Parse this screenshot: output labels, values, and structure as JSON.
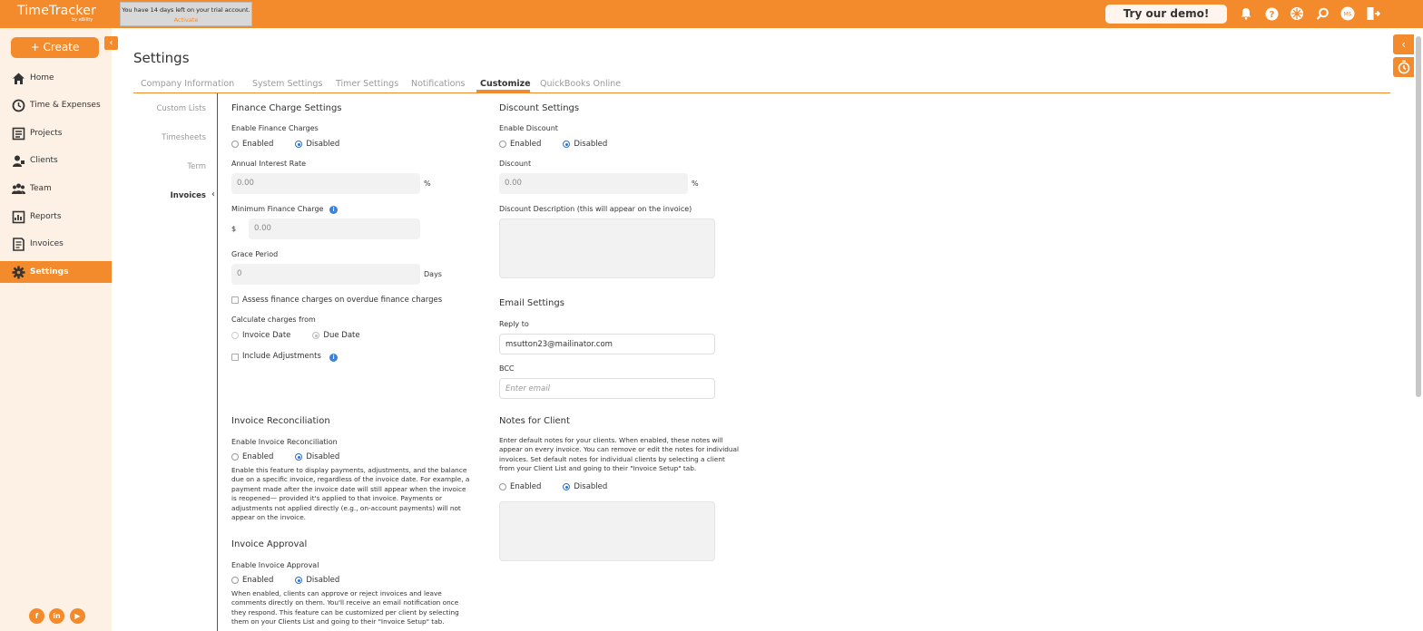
{
  "app": {
    "logo": "TimeTracker",
    "logo_sub": "by eBility",
    "trial_text": "You have 14 days left on your trial account.",
    "trial_link": "Activate",
    "demo_button": "Try our demo!",
    "avatar_initials": "MS"
  },
  "sidebar": {
    "create_label": "+ Create",
    "items": [
      {
        "label": "Home",
        "icon": "home-icon"
      },
      {
        "label": "Time & Expenses",
        "icon": "clock-icon"
      },
      {
        "label": "Projects",
        "icon": "projects-icon"
      },
      {
        "label": "Clients",
        "icon": "clients-icon"
      },
      {
        "label": "Team",
        "icon": "team-icon"
      },
      {
        "label": "Reports",
        "icon": "reports-icon"
      },
      {
        "label": "Invoices",
        "icon": "invoices-icon"
      },
      {
        "label": "Settings",
        "icon": "gear-icon",
        "active": true
      }
    ],
    "social": [
      "f",
      "in",
      "▶"
    ]
  },
  "page": {
    "title": "Settings",
    "tabs": [
      "Company Information",
      "System Settings",
      "Timer Settings",
      "Notifications",
      "Customize",
      "QuickBooks Online"
    ],
    "active_tab": "Customize",
    "subnav": [
      "Custom Lists",
      "Timesheets",
      "Term",
      "Invoices"
    ],
    "active_subnav": "Invoices"
  },
  "finance": {
    "title": "Finance Charge Settings",
    "enable_label": "Enable Finance Charges",
    "enabled": "Enabled",
    "disabled": "Disabled",
    "interest_label": "Annual Interest Rate",
    "interest_value": "0.00",
    "percent": "%",
    "min_label": "Minimum Finance Charge",
    "currency": "$",
    "min_value": "0.00",
    "grace_label": "Grace Period",
    "grace_value": "0",
    "days": "Days",
    "assess_label": "Assess finance charges on overdue finance charges",
    "calc_label": "Calculate charges from",
    "invoice_date": "Invoice Date",
    "due_date": "Due Date",
    "adjust_label": "Include Adjustments"
  },
  "discount": {
    "title": "Discount Settings",
    "enable_label": "Enable Discount",
    "enabled": "Enabled",
    "disabled": "Disabled",
    "discount_label": "Discount",
    "discount_value": "0.00",
    "percent": "%",
    "desc_label": "Discount Description (this will appear on the invoice)"
  },
  "email": {
    "title": "Email Settings",
    "reply_label": "Reply to",
    "reply_value": "msutton23@mailinator.com",
    "bcc_label": "BCC",
    "bcc_placeholder": "Enter email"
  },
  "reconciliation": {
    "title": "Invoice Reconciliation",
    "enable_label": "Enable Invoice Reconciliation",
    "enabled": "Enabled",
    "disabled": "Disabled",
    "lines": [
      "Enable this feature to display payments, adjustments, and the balance",
      "due on a specific invoice, regardless of the invoice date. For example, a",
      "payment made after the invoice date will still appear when the invoice",
      "is reopened— provided it's applied to that invoice. Payments or",
      "adjustments not applied directly (e.g., on-account payments) will not",
      "appear on the invoice."
    ]
  },
  "approval": {
    "title": "Invoice Approval",
    "enable_label": "Enable Invoice Approval",
    "enabled": "Enabled",
    "disabled": "Disabled",
    "lines": [
      "When enabled, clients can approve or reject invoices and leave",
      "comments directly on them. You'll receive an email notification once",
      "they respond. This feature can be customized per client by selecting",
      "them on your Clients List and going to their \"Invoice Setup\" tab."
    ]
  },
  "notes": {
    "title": "Notes for Client",
    "lines": [
      "Enter default notes for your clients. When enabled, these notes will",
      "appear on every invoice. You can remove or edit the notes for individual",
      "invoices. Set default notes for individual clients by selecting a client",
      "from your Client List and going to their \"Invoice Setup\" tab."
    ],
    "enabled": "Enabled",
    "disabled": "Disabled"
  },
  "colors": {
    "accent": "#f38a2b",
    "radio_selected": "#2f6fd0"
  }
}
